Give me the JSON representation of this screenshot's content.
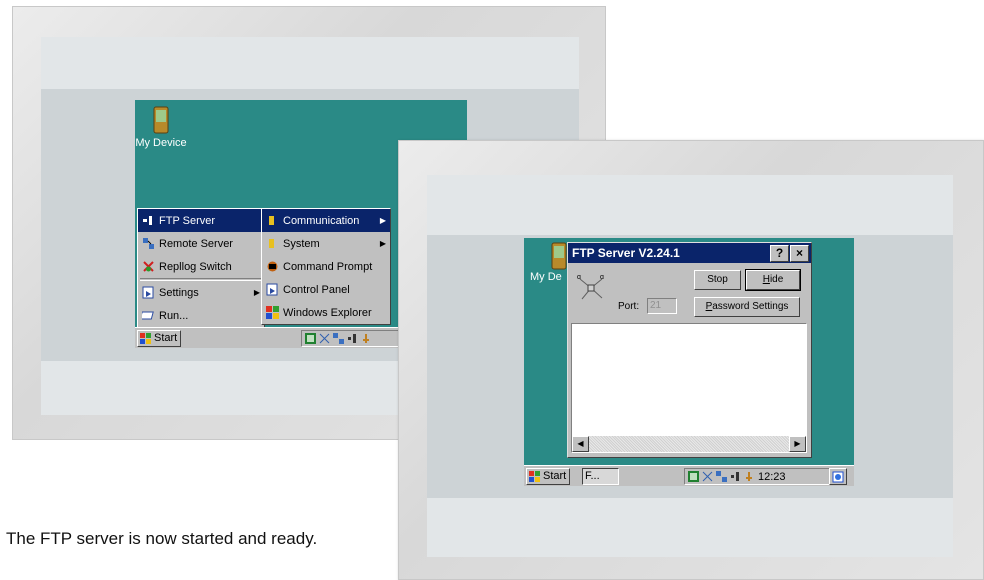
{
  "left_device": {
    "desktop_icon": {
      "label": "My Device",
      "icon": "handheld-device-icon"
    },
    "start_menu": {
      "items": [
        {
          "label": "FTP Server",
          "icon": "ftp-server-icon",
          "selected": true
        },
        {
          "label": "Remote Server",
          "icon": "remote-server-icon"
        },
        {
          "label": "Repllog Switch",
          "icon": "repllog-switch-icon"
        },
        {
          "label": "Settings",
          "icon": "settings-icon",
          "has_submenu": true
        },
        {
          "label": "Run...",
          "icon": "run-icon"
        }
      ]
    },
    "submenu": {
      "items": [
        {
          "label": "Communication",
          "icon": "folder-icon",
          "has_submenu": true,
          "selected": true
        },
        {
          "label": "System",
          "icon": "folder-icon",
          "has_submenu": true
        },
        {
          "label": "Command Prompt",
          "icon": "command-prompt-icon"
        },
        {
          "label": "Control Panel",
          "icon": "control-panel-icon"
        },
        {
          "label": "Windows Explorer",
          "icon": "windows-explorer-icon"
        }
      ]
    },
    "taskbar": {
      "start_label": "Start"
    }
  },
  "right_device": {
    "desktop_icon": {
      "label": "My De",
      "icon": "handheld-device-icon"
    },
    "ftp_window": {
      "title": "FTP Server V2.24.1",
      "help_glyph": "?",
      "close_glyph": "×",
      "stop_label": "Stop",
      "hide_label": "Hide",
      "hide_mnemonic": "H",
      "hide_rest": "ide",
      "port_label": "Port:",
      "port_value": "21",
      "password_settings_label": "Password Settings",
      "password_mnemonic": "P",
      "password_rest": "assword Settings",
      "scroll_left_glyph": "◀",
      "scroll_right_glyph": "▶"
    },
    "taskbar": {
      "start_label": "Start",
      "task_button_label": "F...",
      "clock": "12:23"
    }
  },
  "caption": "The FTP server is now started and ready.",
  "colors": {
    "desktop": "#2a8a86",
    "title_bar": "#0a246a",
    "face": "#c0c0c0"
  }
}
